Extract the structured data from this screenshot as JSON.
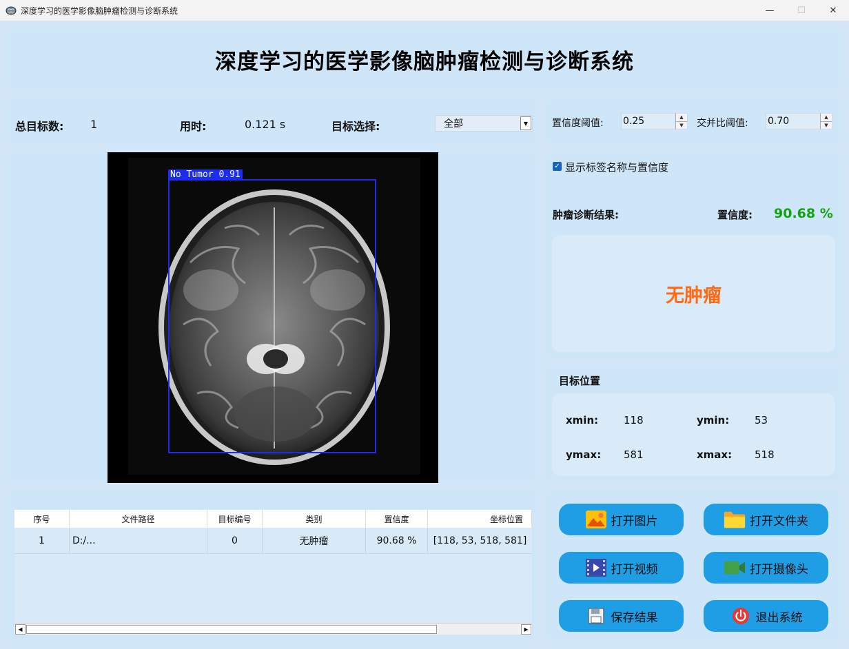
{
  "window": {
    "title": "深度学习的医学影像脑肿瘤检测与诊断系统",
    "minimize": "—",
    "maximize": "☐",
    "close": "✕"
  },
  "header": {
    "title": "深度学习的医学影像脑肿瘤检测与诊断系统"
  },
  "stats": {
    "total_label": "总目标数:",
    "total_value": "1",
    "time_label": "用时:",
    "time_value": "0.121 s",
    "target_label": "目标选择:",
    "target_selected": "全部"
  },
  "thresholds": {
    "conf_label": "置信度阈值:",
    "conf_value": "0.25",
    "iou_label": "交并比阈值:",
    "iou_value": "0.70"
  },
  "detection": {
    "label": "No Tumor 0.91"
  },
  "result": {
    "show_label_text": "显示标签名称与置信度",
    "show_label_checked": true,
    "diagnosis_label": "肿瘤诊断结果:",
    "confidence_label": "置信度:",
    "confidence_value": "90.68 %",
    "diagnosis": "无肿瘤"
  },
  "position": {
    "title": "目标位置",
    "xmin_label": "xmin:",
    "xmin": "118",
    "ymin_label": "ymin:",
    "ymin": "53",
    "ymax_label": "ymax:",
    "ymax": "581",
    "xmax_label": "xmax:",
    "xmax": "518"
  },
  "table": {
    "headers": [
      "序号",
      "文件路径",
      "目标编号",
      "类别",
      "置信度",
      "坐标位置"
    ],
    "rows": [
      [
        "1",
        "D:/...",
        "0",
        "无肿瘤",
        "90.68 %",
        "[118, 53, 518, 581]"
      ]
    ]
  },
  "actions": {
    "open_image": "打开图片",
    "open_folder": "打开文件夹",
    "open_video": "打开视频",
    "open_camera": "打开摄像头",
    "save_result": "保存结果",
    "exit_system": "退出系统"
  },
  "colors": {
    "accent_button": "#1f9ee6",
    "confidence_green": "#13a213",
    "diagnosis_orange": "#ff6a13",
    "bbox_blue": "#1d2df0"
  }
}
